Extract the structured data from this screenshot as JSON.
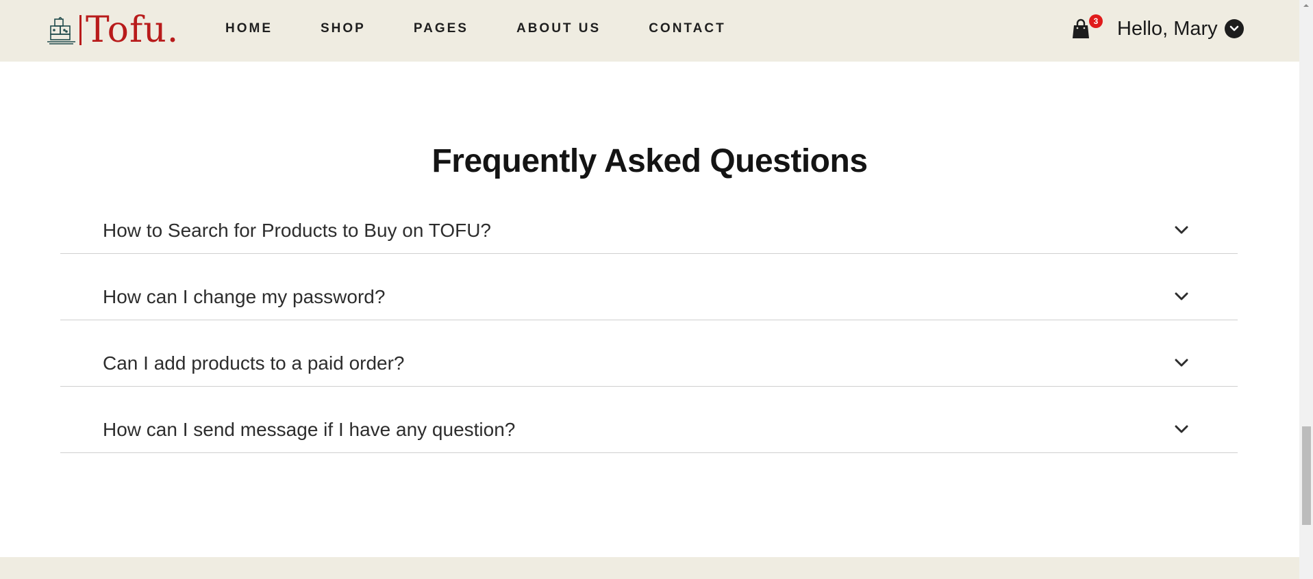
{
  "header": {
    "logo": {
      "text": "Tofu.",
      "icon": "tofu-logo-icon"
    },
    "nav": [
      {
        "label": "HOME"
      },
      {
        "label": "SHOP"
      },
      {
        "label": "PAGES"
      },
      {
        "label": "ABOUT US"
      },
      {
        "label": "CONTACT"
      }
    ],
    "cart": {
      "icon": "shopping-bag-icon",
      "count": "3"
    },
    "user": {
      "greeting": "Hello, Mary",
      "icon": "chevron-down-circle-icon"
    }
  },
  "faq": {
    "title": "Frequently Asked Questions",
    "items": [
      {
        "question": "How to Search for Products to Buy on TOFU?"
      },
      {
        "question": "How can I change my password?"
      },
      {
        "question": "Can I add products to a paid order?"
      },
      {
        "question": "How can I send message if I have any question?"
      }
    ]
  },
  "colors": {
    "header_bg": "#efece1",
    "brand_red": "#b81b1b",
    "badge_red": "#e01b1b",
    "divider": "#cfcfcf"
  }
}
